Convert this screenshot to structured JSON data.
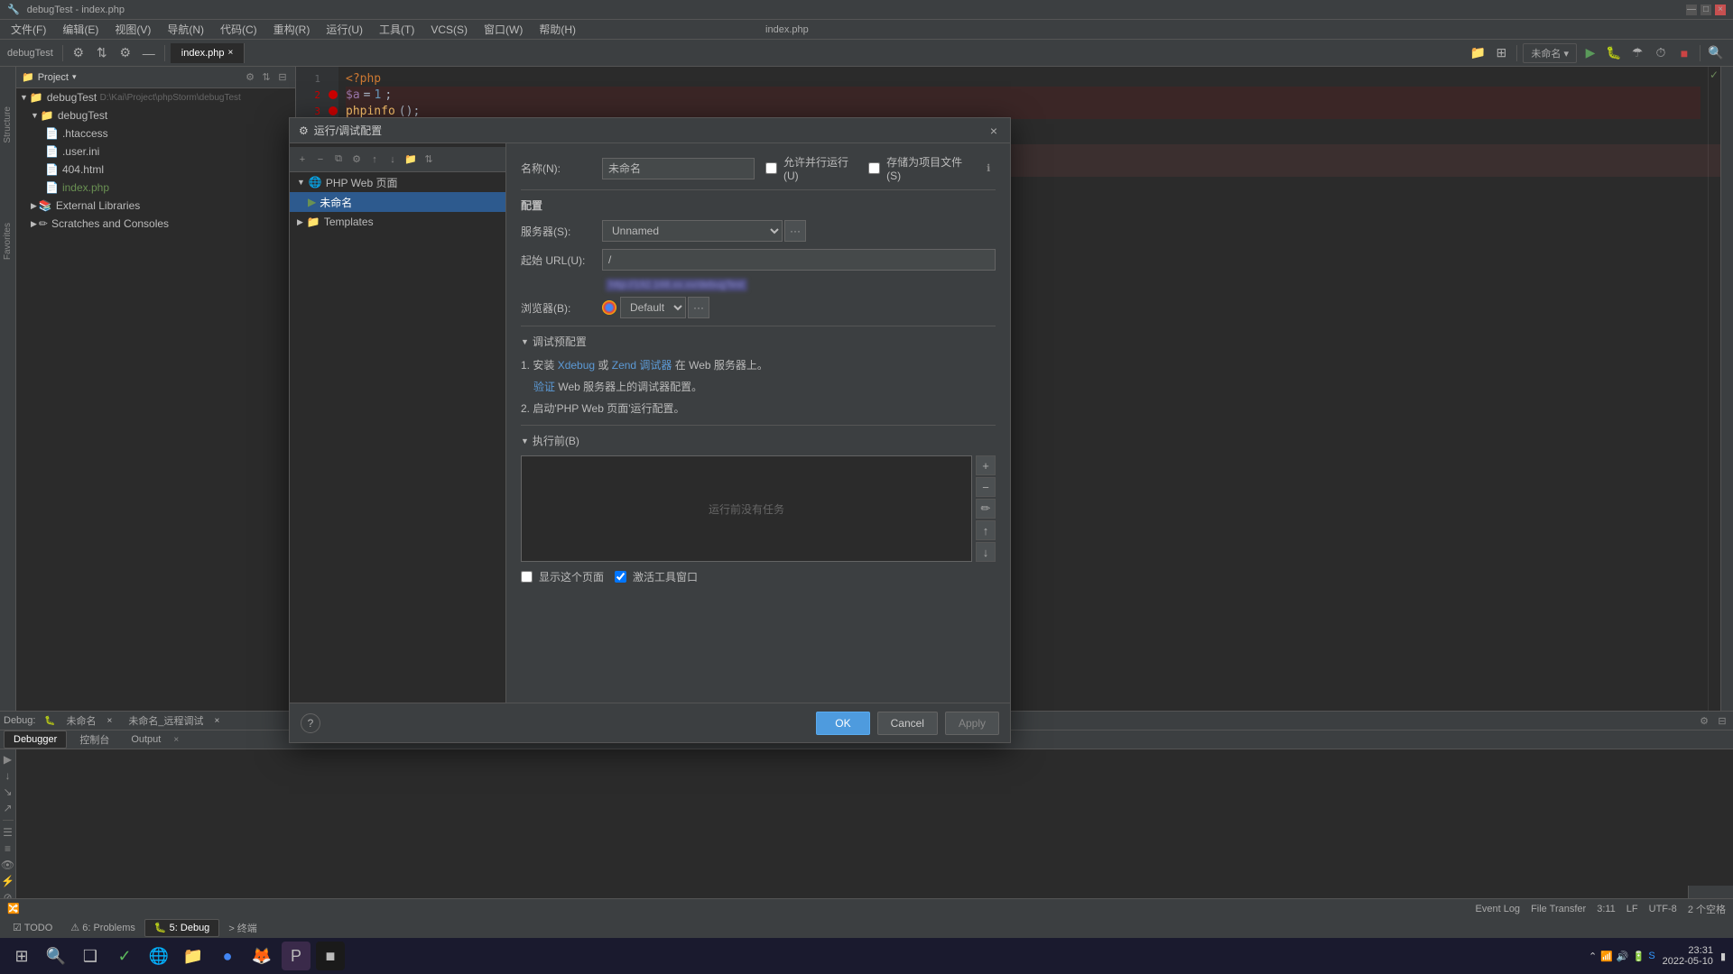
{
  "app": {
    "title": "debugTest - index.php",
    "product": "debugTest",
    "file": "index.php"
  },
  "titlebar": {
    "buttons": [
      "—",
      "□",
      "×"
    ]
  },
  "menubar": {
    "items": [
      "文件(F)",
      "编辑(E)",
      "视图(V)",
      "导航(N)",
      "代码(C)",
      "重构(R)",
      "运行(U)",
      "工具(T)",
      "VCS(S)",
      "窗口(W)",
      "帮助(H)"
    ]
  },
  "toolbar": {
    "run_name": "未命名",
    "tab": "index.php"
  },
  "project_panel": {
    "title": "Project",
    "root": "debugTest",
    "root_path": "D:\\Kai\\Project\\phpStorm\\debugTest",
    "files": [
      {
        "name": ".htaccess",
        "icon": "📄",
        "indent": 1
      },
      {
        "name": ".user.ini",
        "icon": "📄",
        "indent": 1
      },
      {
        "name": "404.html",
        "icon": "📄",
        "indent": 1
      },
      {
        "name": "index.php",
        "icon": "📄",
        "indent": 1
      }
    ],
    "external": "External Libraries",
    "scratches": "Scratches and Consoles"
  },
  "code": {
    "filename": "index.php",
    "lines": [
      {
        "num": 1,
        "text": "<?php",
        "breakpoint": false
      },
      {
        "num": 2,
        "text": "$a = 1;",
        "breakpoint": true
      },
      {
        "num": 3,
        "text": "phpinfo();",
        "breakpoint": true
      }
    ]
  },
  "debug_panel": {
    "title": "Debug",
    "tabs": [
      {
        "label": "未命名",
        "active": false
      },
      {
        "label": "未命名_远程调试",
        "active": false
      }
    ],
    "sub_tabs": [
      "Debugger",
      "控制台",
      "Output"
    ]
  },
  "bottom_tabs": [
    {
      "label": "TODO",
      "icon": "☑"
    },
    {
      "label": "6: Problems",
      "icon": "⚠"
    },
    {
      "label": "5: Debug",
      "icon": "🐛",
      "active": true
    },
    {
      "label": "终端",
      "icon": ">"
    }
  ],
  "modal": {
    "title": "运行/调试配置",
    "name_label": "名称(N):",
    "name_value": "未命名",
    "checkboxes": {
      "allow_parallel": "允许并行运行(U)",
      "save_to_project": "存储为项目文件(S)"
    },
    "config_section": "配置",
    "server_label": "服务器(S):",
    "server_value": "Unnamed",
    "url_label": "起始 URL(U):",
    "url_value": "/",
    "url_hint": "[blurred url]",
    "browser_label": "浏览器(B):",
    "browser_value": "Default",
    "debug_config_title": "调试预配置",
    "debug_steps": [
      "1. 安装 Xdebug 或 Zend 调试器 在 Web 服务器上。",
      "   验证 Web 服务器上的调试器配置。",
      "2. 启动'PHP Web 页面'运行配置。"
    ],
    "before_launch_title": "执行前(B)",
    "before_launch_empty": "运行前没有任务",
    "show_page_label": "显示这个页面",
    "activate_window_label": "激活工具窗口",
    "tree": {
      "items": [
        {
          "label": "PHP Web 页面",
          "indent": 0,
          "expanded": true,
          "icon": "🌐"
        },
        {
          "label": "未命名",
          "indent": 1,
          "selected": true,
          "icon": "▶"
        },
        {
          "label": "Templates",
          "indent": 0,
          "expanded": false,
          "icon": "📁"
        }
      ]
    },
    "buttons": {
      "ok": "OK",
      "cancel": "Cancel",
      "apply": "Apply"
    }
  },
  "statusbar": {
    "left": "3:11",
    "lf": "LF",
    "encoding": "UTF-8",
    "columns": "2 个空格",
    "event_log": "Event Log",
    "file_transfer": "File Transfer"
  },
  "taskbar": {
    "time": "23:31",
    "date": "2022-05-10",
    "apps": [
      "⊞",
      "⬤",
      "❑",
      "✓",
      "S",
      "E",
      "◎",
      "P",
      "■"
    ]
  }
}
